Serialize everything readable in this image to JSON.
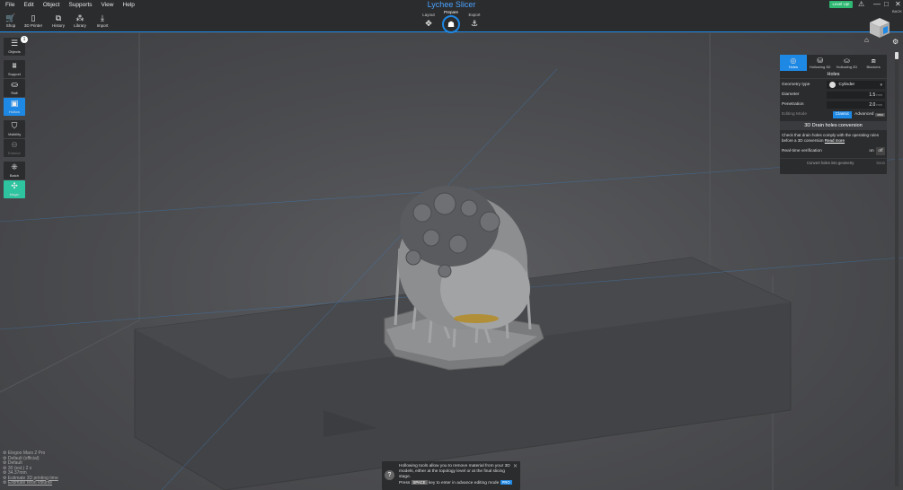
{
  "menu": [
    "File",
    "Edit",
    "Object",
    "Supports",
    "View",
    "Help"
  ],
  "app_title": "Lychee Slicer",
  "toolbar": {
    "shop": "Shop",
    "printer": "3D Printer",
    "history": "History",
    "library": "Library",
    "import": "Import"
  },
  "modes": {
    "layout": "Layout",
    "prepare": "Prepare",
    "export": "Export"
  },
  "level_up": "Level Up!",
  "cube_label": "BACK",
  "sidebar": {
    "objects": "Objects",
    "objects_count": "1",
    "support": "Support",
    "raft": "Raft",
    "hollow": "Hollow",
    "visibility": "Visibility",
    "exterior": "Exterior",
    "batch": "Batch",
    "magic": "Magic"
  },
  "panel": {
    "tabs": [
      "Holes",
      "Hollowing 3D",
      "Hollowing 2D",
      "Blockers"
    ],
    "title": "Holes",
    "geometry_label": "Geometry type",
    "geometry_value": "Cylinder",
    "diameter_label": "Diameter",
    "diameter_value": "1.5",
    "penetration_label": "Penetration",
    "penetration_value": "2.0",
    "unit": "mm",
    "editing_label": "Editing Mode",
    "classic": "Classic",
    "advanced": "Advanced",
    "pro": "PRO",
    "section_title": "3D Drain holes conversion",
    "info_text": "Check that drain holes comply with the operating rules before a 3D conversion",
    "read_more": "Read more",
    "realtime_label": "Real-time verification",
    "on": "on",
    "off": "off",
    "convert_label": "Convert holes into geometry",
    "soon": "Soon"
  },
  "printer_info": {
    "printer": "Elegoo Mars 2 Pro",
    "profile": "Default",
    "official": "(official)",
    "resin": "Default",
    "object": "Object",
    "objects_line": "30 (est.) 2 x",
    "height": "34.37mm",
    "estimate_time": "Estimate 3D printing time",
    "estimate_resin": "Estimate resin volume"
  },
  "tip": {
    "line1": "Hollowing tools allow you to remove material from your 3D models, either at the topology level or at the final slicing stage.",
    "press": "Press",
    "key": "SPACE",
    "rest": "key to enter in advance editing mode",
    "pro": "PRO"
  },
  "colors": {
    "accent": "#1e88e5",
    "magic": "#2ec4a0",
    "level_up": "#2eb872",
    "panel_bg": "#2b2c2e"
  }
}
